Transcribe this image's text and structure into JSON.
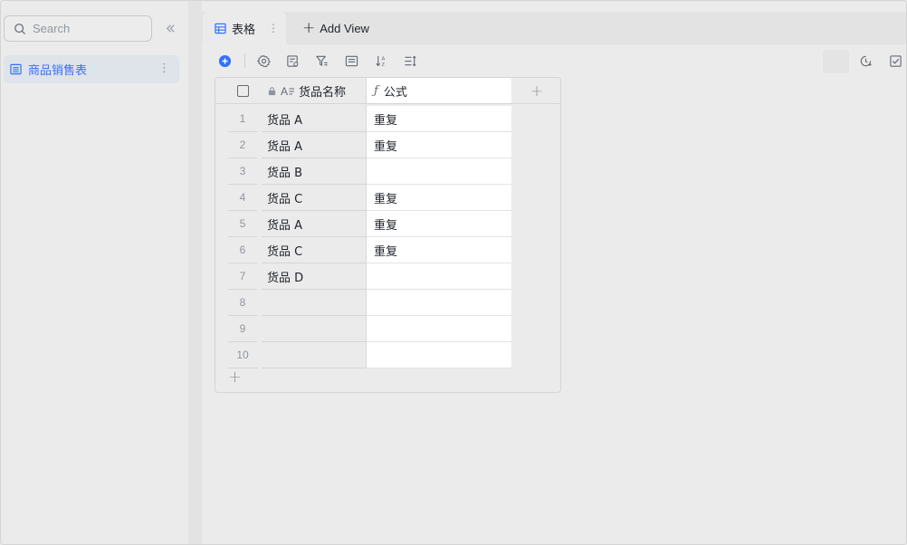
{
  "sidebar": {
    "search": {
      "placeholder": "Search"
    },
    "collapse_icon": "double-chevron-left-icon",
    "tables": [
      {
        "label": "商品销售表",
        "icon": "table-icon"
      }
    ]
  },
  "tabs": {
    "views": [
      {
        "label": "表格",
        "icon": "grid-icon"
      }
    ],
    "add_view_label": "Add View"
  },
  "toolbar": {
    "icons": [
      "add-record-icon",
      "settings-icon",
      "field-config-icon",
      "filter-icon",
      "group-icon",
      "sort-icon",
      "row-height-icon",
      "history-icon",
      "checklist-icon"
    ]
  },
  "grid": {
    "columns": [
      {
        "label": "货品名称",
        "type": "text",
        "locked": true
      },
      {
        "label": "公式",
        "type": "formula"
      }
    ],
    "rows": [
      {
        "index": "1",
        "name": "货品 A",
        "formula": "重复"
      },
      {
        "index": "2",
        "name": "货品 A",
        "formula": "重复"
      },
      {
        "index": "3",
        "name": "货品 B",
        "formula": ""
      },
      {
        "index": "4",
        "name": "货品 C",
        "formula": "重复"
      },
      {
        "index": "5",
        "name": "货品 A",
        "formula": "重复"
      },
      {
        "index": "6",
        "name": "货品 C",
        "formula": "重复"
      },
      {
        "index": "7",
        "name": "货品 D",
        "formula": ""
      },
      {
        "index": "8",
        "name": "",
        "formula": ""
      },
      {
        "index": "9",
        "name": "",
        "formula": ""
      },
      {
        "index": "10",
        "name": "",
        "formula": ""
      }
    ]
  },
  "colors": {
    "accent": "#3370ff",
    "sidebar_selected_bg": "#dfe3ea",
    "muted_text": "#8f959e"
  }
}
